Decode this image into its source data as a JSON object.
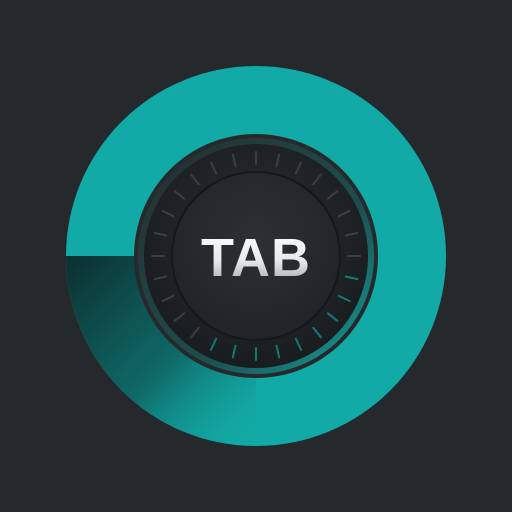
{
  "app_icon": {
    "label": "TAB",
    "icon": "tab-dial-icon",
    "colors": {
      "background": "#26292c",
      "ring": "#12aaa6",
      "ring_shade": "#0b3a3a",
      "dial": "#1c1f22",
      "label_light": "#ffffff",
      "label_dark": "#9a9ea2"
    }
  }
}
